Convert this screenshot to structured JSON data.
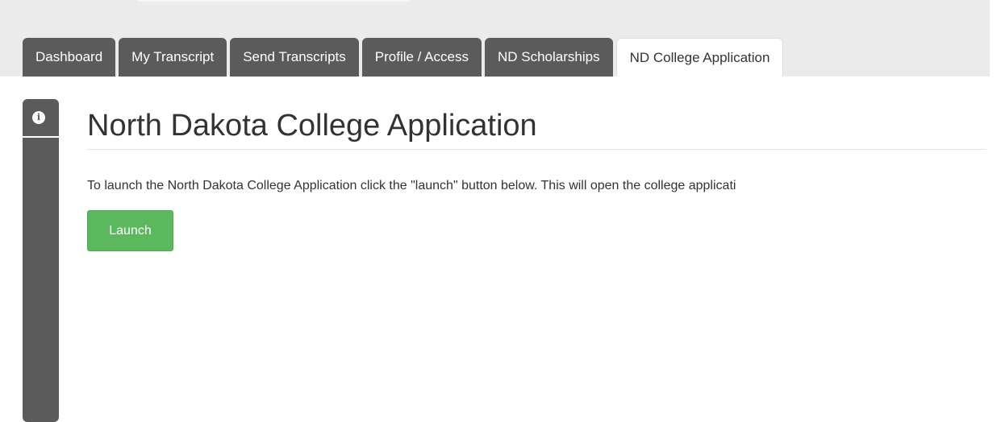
{
  "tabs": [
    {
      "label": "Dashboard",
      "active": false
    },
    {
      "label": "My Transcript",
      "active": false
    },
    {
      "label": "Send Transcripts",
      "active": false
    },
    {
      "label": "Profile / Access",
      "active": false
    },
    {
      "label": "ND Scholarships",
      "active": false
    },
    {
      "label": "ND College Application",
      "active": true
    }
  ],
  "sidebar": {
    "icon": "info-icon",
    "icon_glyph": "i"
  },
  "main": {
    "title": "North Dakota College Application",
    "instructions": "To launch the North Dakota College Application click the \"launch\" button below. This will open the college applicati",
    "launch_label": "Launch"
  },
  "colors": {
    "tab_background": "#5b5b5b",
    "active_tab_background": "#ffffff",
    "launch_button": "#5cb85c",
    "page_background": "#ebebeb"
  }
}
